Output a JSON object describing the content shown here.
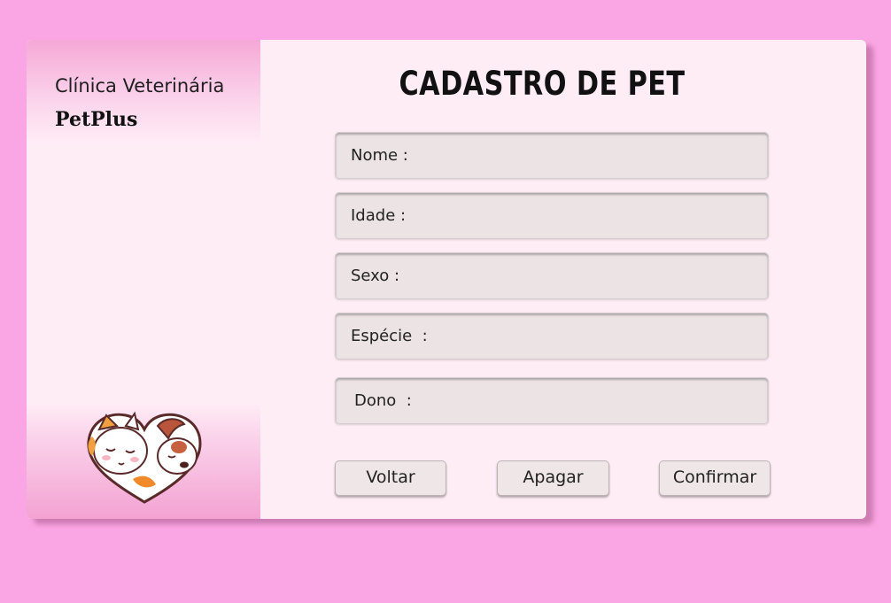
{
  "sidebar": {
    "brand_line1": "Clínica Veterinária",
    "brand_line2": "PetPlus",
    "logo_icon": "cat-dog-heart-icon"
  },
  "form": {
    "title": "CADASTRO DE PET",
    "fields": [
      {
        "label": "Nome :",
        "value": ""
      },
      {
        "label": "Idade :",
        "value": ""
      },
      {
        "label": "Sexo :",
        "value": ""
      },
      {
        "label": "Espécie  :",
        "value": ""
      },
      {
        "label": "Dono  :",
        "value": ""
      }
    ]
  },
  "buttons": {
    "back": "Voltar",
    "clear": "Apagar",
    "confirm": "Confirmar"
  },
  "colors": {
    "background": "#fba6e4",
    "card": "#ffedf6",
    "sidebar_accent": "#f3a2d2",
    "field": "#ece3e5",
    "button": "#efe6e8"
  }
}
